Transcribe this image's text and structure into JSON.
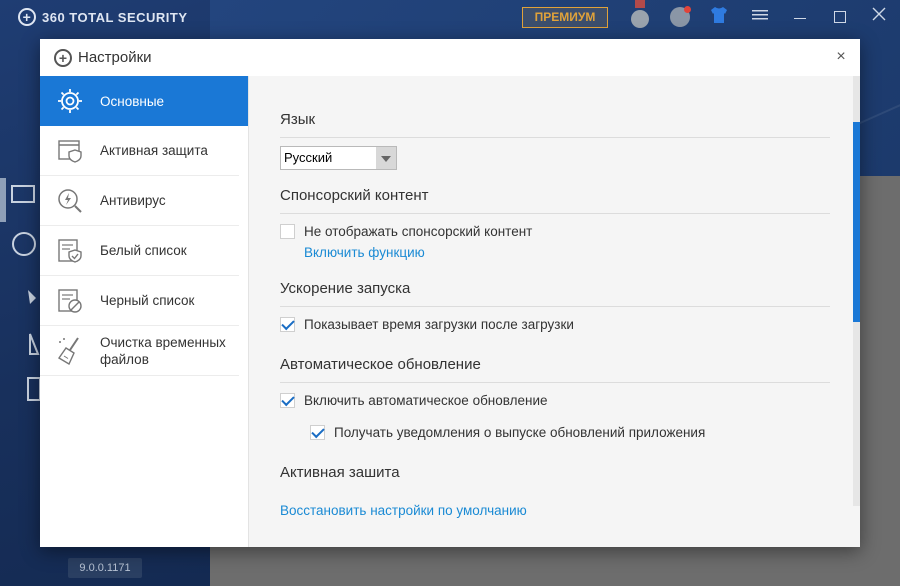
{
  "app": {
    "brand": "360 TOTAL SECURITY",
    "premium_label": "ПРЕМИУМ",
    "version": "9.0.0.1171"
  },
  "dialog": {
    "title": "Настройки",
    "close_glyph": "×"
  },
  "sidebar": {
    "items": [
      {
        "label": "Основные",
        "icon": "gear-icon",
        "active": true
      },
      {
        "label": "Активная защита",
        "icon": "shield-window-icon",
        "active": false
      },
      {
        "label": "Антивирус",
        "icon": "lightning-search-icon",
        "active": false
      },
      {
        "label": "Белый список",
        "icon": "whitelist-icon",
        "active": false
      },
      {
        "label": "Черный список",
        "icon": "blacklist-icon",
        "active": false
      },
      {
        "label": "Очистка временных файлов",
        "label_line1": "Очистка временных",
        "label_line2": "файлов",
        "icon": "broom-icon",
        "active": false
      }
    ]
  },
  "content": {
    "language": {
      "heading": "Язык",
      "selected": "Русский"
    },
    "sponsored": {
      "heading": "Спонсорский контент",
      "checkbox_label": "Не отображать спонсорский контент",
      "checked": false,
      "link": "Включить функцию"
    },
    "startup": {
      "heading": "Ускорение запуска",
      "checkbox_label": "Показывает время загрузки после загрузки",
      "checked": true
    },
    "autoupdate": {
      "heading": "Автоматическое обновление",
      "checkbox_label": "Включить автоматическое обновление",
      "checked": true,
      "sub_checkbox_label": "Получать уведомления о выпуске обновлений приложения",
      "sub_checked": true
    },
    "active_protection": {
      "heading": "Активная зашита"
    },
    "restore_link": "Восстановить настройки по умолчанию"
  },
  "colors": {
    "accent": "#1a78d6",
    "link": "#1a8ad4",
    "premium": "#e0a23a"
  }
}
